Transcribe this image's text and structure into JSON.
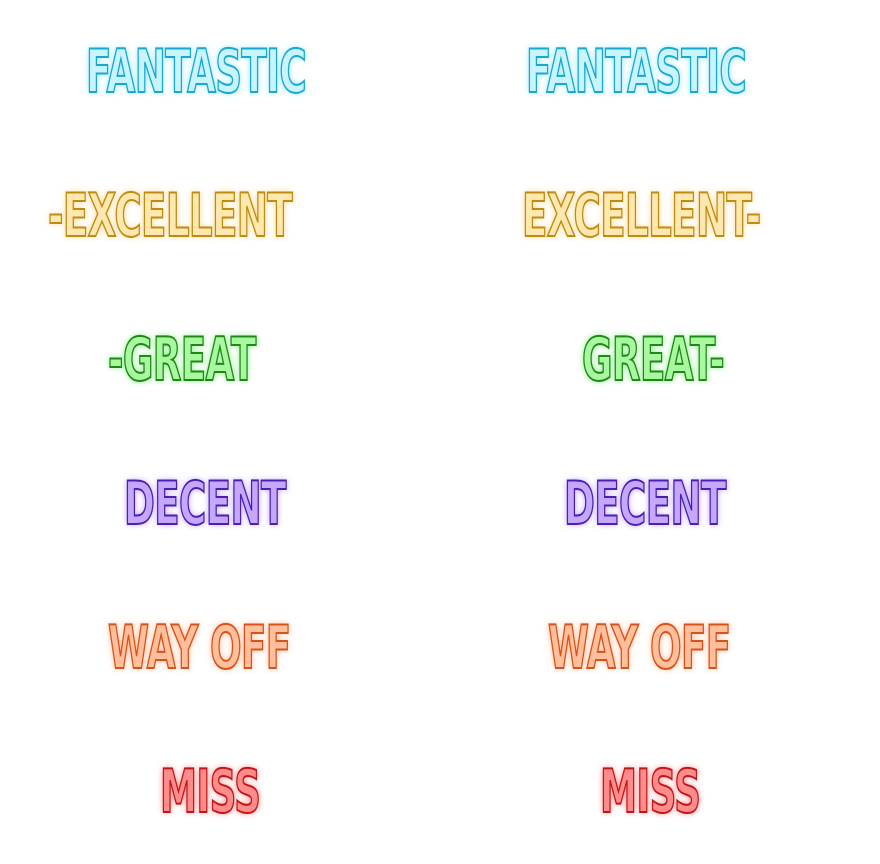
{
  "judgments": {
    "left": {
      "fantastic": "FANTASTIC",
      "excellent": "-EXCELLENT",
      "great": "-GREAT",
      "decent": "DECENT",
      "way_off": "WAY OFF",
      "miss": "MISS"
    },
    "right": {
      "fantastic": "FANTASTIC",
      "excellent": "EXCELLENT-",
      "great": "GREAT-",
      "decent": "DECENT",
      "way_off": "WAY OFF",
      "miss": "MISS"
    }
  },
  "colors": {
    "fantastic": {
      "fill": "#c8f4fd",
      "outline": "#1aa8cf"
    },
    "excellent": {
      "fill": "#fde8b0",
      "outline": "#c08b12"
    },
    "great": {
      "fill": "#a9f7a1",
      "outline": "#1d8a14"
    },
    "decent": {
      "fill": "#c5a8fb",
      "outline": "#4a1fb2"
    },
    "way_off": {
      "fill": "#ffbf9c",
      "outline": "#d6531a"
    },
    "miss": {
      "fill": "#ff8c8c",
      "outline": "#c01818"
    },
    "background": "#ffffff"
  }
}
